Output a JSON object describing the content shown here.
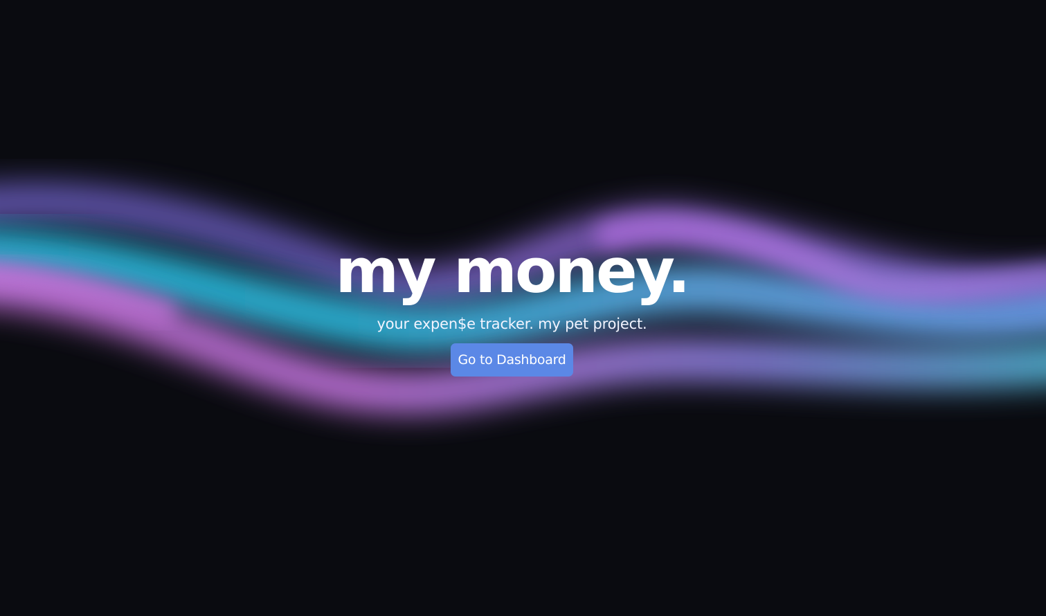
{
  "hero": {
    "title": "my money.",
    "subtitle": "your expen$e tracker. my pet project.",
    "cta_label": "Go to Dashboard"
  },
  "colors": {
    "background": "#0a0b10",
    "wave_cyan": "#2fb4d8",
    "wave_violet": "#9a6fe0",
    "wave_pink": "#c978e6",
    "wave_blue": "#6a9be8",
    "button": "#5b88e6",
    "text": "#ffffff"
  }
}
